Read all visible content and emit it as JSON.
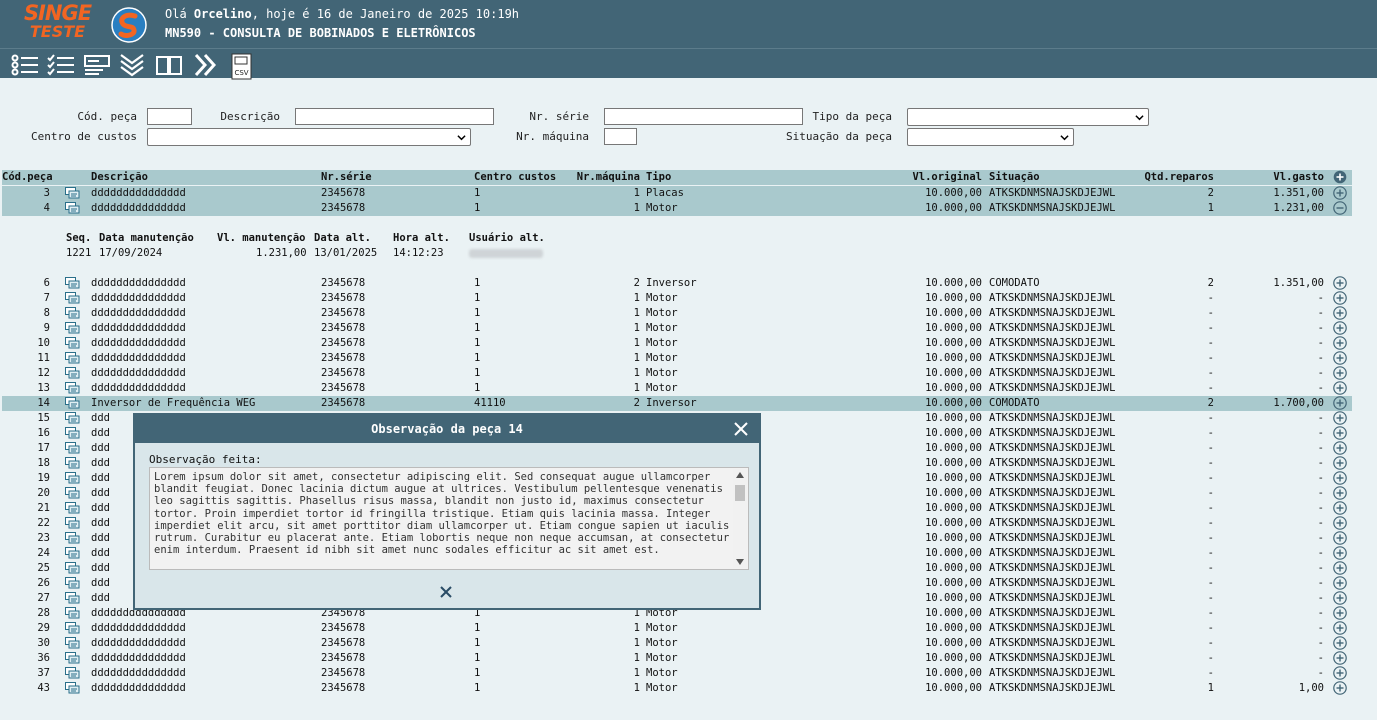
{
  "header": {
    "logo_line1": "SINGE",
    "logo_line2": "TESTE",
    "greeting_prefix": "Olá ",
    "user": "Orcelino",
    "greeting_suffix": ", hoje é 16 de Janeiro de 2025 10:19h",
    "title": "MN590 - CONSULTA DE BOBINADOS E ELETRÔNICOS"
  },
  "toolbar": {
    "icons": [
      "list-icon",
      "checklist-icon",
      "form-icon",
      "expand-all-icon",
      "manual-icon",
      "next-icon",
      "csv-export-icon"
    ],
    "csv_label": "CSV"
  },
  "filters": {
    "cod_peca": "Cód. peça",
    "descricao": "Descrição",
    "nr_serie": "Nr. série",
    "tipo_peca": "Tipo da peça",
    "centro_custos": "Centro de custos",
    "nr_maquina": "Nr. máquina",
    "situacao_peca": "Situação da peça"
  },
  "grid": {
    "headers": {
      "cod": "Cód.peça",
      "desc": "Descrição",
      "serie": "Nr.série",
      "cc": "Centro custos",
      "nm": "Nr.máquina",
      "tipo": "Tipo",
      "vo": "Vl.original",
      "sit": "Situação",
      "qt": "Qtd.reparos",
      "vg": "Vl.gasto"
    }
  },
  "rows_top": [
    {
      "cod": "3",
      "desc": "ddddddddddddddd",
      "serie": "2345678",
      "cc": "1",
      "nm": "1",
      "tipo": "Placas",
      "vo": "10.000,00",
      "sit": "ATKSKDNMSNAJSKDJEJWL",
      "qt": "2",
      "vg": "1.351,00",
      "exp": "+"
    },
    {
      "cod": "4",
      "desc": "ddddddddddddddd",
      "serie": "2345678",
      "cc": "1",
      "nm": "1",
      "tipo": "Motor",
      "vo": "10.000,00",
      "sit": "ATKSKDNMSNAJSKDJEJWL",
      "qt": "1",
      "vg": "1.231,00",
      "exp": "-"
    }
  ],
  "sub": {
    "h_seq": "Seq.",
    "h_data": "Data manutenção",
    "h_vl": "Vl. manutenção",
    "h_alt": "Data alt.",
    "h_hora": "Hora alt.",
    "h_user": "Usuário alt.",
    "seq": "1221",
    "data": "17/09/2024",
    "vl": "1.231,00",
    "alt": "13/01/2025",
    "hora": "14:12:23"
  },
  "rows": [
    {
      "cod": "6",
      "desc": "ddddddddddddddd",
      "serie": "2345678",
      "cc": "1",
      "nm": "2",
      "tipo": "Inversor",
      "vo": "10.000,00",
      "sit": "COMODATO",
      "qt": "2",
      "vg": "1.351,00"
    },
    {
      "cod": "7",
      "desc": "ddddddddddddddd",
      "serie": "2345678",
      "cc": "1",
      "nm": "1",
      "tipo": "Motor",
      "vo": "10.000,00",
      "sit": "ATKSKDNMSNAJSKDJEJWL",
      "qt": "-",
      "vg": "-"
    },
    {
      "cod": "8",
      "desc": "ddddddddddddddd",
      "serie": "2345678",
      "cc": "1",
      "nm": "1",
      "tipo": "Motor",
      "vo": "10.000,00",
      "sit": "ATKSKDNMSNAJSKDJEJWL",
      "qt": "-",
      "vg": "-"
    },
    {
      "cod": "9",
      "desc": "ddddddddddddddd",
      "serie": "2345678",
      "cc": "1",
      "nm": "1",
      "tipo": "Motor",
      "vo": "10.000,00",
      "sit": "ATKSKDNMSNAJSKDJEJWL",
      "qt": "-",
      "vg": "-"
    },
    {
      "cod": "10",
      "desc": "ddddddddddddddd",
      "serie": "2345678",
      "cc": "1",
      "nm": "1",
      "tipo": "Motor",
      "vo": "10.000,00",
      "sit": "ATKSKDNMSNAJSKDJEJWL",
      "qt": "-",
      "vg": "-"
    },
    {
      "cod": "11",
      "desc": "ddddddddddddddd",
      "serie": "2345678",
      "cc": "1",
      "nm": "1",
      "tipo": "Motor",
      "vo": "10.000,00",
      "sit": "ATKSKDNMSNAJSKDJEJWL",
      "qt": "-",
      "vg": "-"
    },
    {
      "cod": "12",
      "desc": "ddddddddddddddd",
      "serie": "2345678",
      "cc": "1",
      "nm": "1",
      "tipo": "Motor",
      "vo": "10.000,00",
      "sit": "ATKSKDNMSNAJSKDJEJWL",
      "qt": "-",
      "vg": "-"
    },
    {
      "cod": "13",
      "desc": "ddddddddddddddd",
      "serie": "2345678",
      "cc": "1",
      "nm": "1",
      "tipo": "Motor",
      "vo": "10.000,00",
      "sit": "ATKSKDNMSNAJSKDJEJWL",
      "qt": "-",
      "vg": "-"
    },
    {
      "cod": "14",
      "desc": "Inversor de Frequência WEG",
      "serie": "2345678",
      "cc": "41110",
      "nm": "2",
      "tipo": "Inversor",
      "vo": "10.000,00",
      "sit": "COMODATO",
      "qt": "2",
      "vg": "1.700,00",
      "hl": true
    },
    {
      "cod": "15",
      "desc": "ddd",
      "vo": "10.000,00",
      "sit": "ATKSKDNMSNAJSKDJEJWL",
      "qt": "-",
      "vg": "-",
      "hidden": true
    },
    {
      "cod": "16",
      "desc": "ddd",
      "vo": "10.000,00",
      "sit": "ATKSKDNMSNAJSKDJEJWL",
      "qt": "-",
      "vg": "-",
      "hidden": true
    },
    {
      "cod": "17",
      "desc": "ddd",
      "vo": "10.000,00",
      "sit": "ATKSKDNMSNAJSKDJEJWL",
      "qt": "-",
      "vg": "-",
      "hidden": true
    },
    {
      "cod": "18",
      "desc": "ddd",
      "vo": "10.000,00",
      "sit": "ATKSKDNMSNAJSKDJEJWL",
      "qt": "-",
      "vg": "-",
      "hidden": true
    },
    {
      "cod": "19",
      "desc": "ddd",
      "vo": "10.000,00",
      "sit": "ATKSKDNMSNAJSKDJEJWL",
      "qt": "-",
      "vg": "-",
      "hidden": true
    },
    {
      "cod": "20",
      "desc": "ddd",
      "vo": "10.000,00",
      "sit": "ATKSKDNMSNAJSKDJEJWL",
      "qt": "-",
      "vg": "-",
      "hidden": true
    },
    {
      "cod": "21",
      "desc": "ddd",
      "vo": "10.000,00",
      "sit": "ATKSKDNMSNAJSKDJEJWL",
      "qt": "-",
      "vg": "-",
      "hidden": true
    },
    {
      "cod": "22",
      "desc": "ddd",
      "vo": "10.000,00",
      "sit": "ATKSKDNMSNAJSKDJEJWL",
      "qt": "-",
      "vg": "-",
      "hidden": true
    },
    {
      "cod": "23",
      "desc": "ddd",
      "vo": "10.000,00",
      "sit": "ATKSKDNMSNAJSKDJEJWL",
      "qt": "-",
      "vg": "-",
      "hidden": true
    },
    {
      "cod": "24",
      "desc": "ddd",
      "vo": "10.000,00",
      "sit": "ATKSKDNMSNAJSKDJEJWL",
      "qt": "-",
      "vg": "-",
      "hidden": true
    },
    {
      "cod": "25",
      "desc": "ddd",
      "vo": "10.000,00",
      "sit": "ATKSKDNMSNAJSKDJEJWL",
      "qt": "-",
      "vg": "-",
      "hidden": true
    },
    {
      "cod": "26",
      "desc": "ddd",
      "vo": "10.000,00",
      "sit": "ATKSKDNMSNAJSKDJEJWL",
      "qt": "-",
      "vg": "-",
      "hidden": true
    },
    {
      "cod": "27",
      "desc": "ddd",
      "vo": "10.000,00",
      "sit": "ATKSKDNMSNAJSKDJEJWL",
      "qt": "-",
      "vg": "-",
      "hidden": true
    },
    {
      "cod": "28",
      "desc": "ddddddddddddddd",
      "serie": "2345678",
      "cc": "1",
      "nm": "1",
      "tipo": "Motor",
      "vo": "10.000,00",
      "sit": "ATKSKDNMSNAJSKDJEJWL",
      "qt": "-",
      "vg": "-"
    },
    {
      "cod": "29",
      "desc": "ddddddddddddddd",
      "serie": "2345678",
      "cc": "1",
      "nm": "1",
      "tipo": "Motor",
      "vo": "10.000,00",
      "sit": "ATKSKDNMSNAJSKDJEJWL",
      "qt": "-",
      "vg": "-"
    },
    {
      "cod": "30",
      "desc": "ddddddddddddddd",
      "serie": "2345678",
      "cc": "1",
      "nm": "1",
      "tipo": "Motor",
      "vo": "10.000,00",
      "sit": "ATKSKDNMSNAJSKDJEJWL",
      "qt": "-",
      "vg": "-"
    },
    {
      "cod": "36",
      "desc": "ddddddddddddddd",
      "serie": "2345678",
      "cc": "1",
      "nm": "1",
      "tipo": "Motor",
      "vo": "10.000,00",
      "sit": "ATKSKDNMSNAJSKDJEJWL",
      "qt": "-",
      "vg": "-"
    },
    {
      "cod": "37",
      "desc": "ddddddddddddddd",
      "serie": "2345678",
      "cc": "1",
      "nm": "1",
      "tipo": "Motor",
      "vo": "10.000,00",
      "sit": "ATKSKDNMSNAJSKDJEJWL",
      "qt": "-",
      "vg": "-"
    },
    {
      "cod": "43",
      "desc": "ddddddddddddddd",
      "serie": "2345678",
      "cc": "1",
      "nm": "1",
      "tipo": "Motor",
      "vo": "10.000,00",
      "sit": "ATKSKDNMSNAJSKDJEJWL",
      "qt": "1",
      "vg": "1,00"
    }
  ],
  "modal": {
    "title": "Observação da peça 14",
    "label": "Observação feita:",
    "text": "Lorem ipsum dolor sit amet, consectetur adipiscing elit. Sed consequat augue ullamcorper blandit feugiat. Donec lacinia dictum augue at ultrices. Vestibulum pellentesque venenatis leo sagittis sagittis. Phasellus risus massa, blandit non justo id, maximus consectetur tortor. Proin imperdiet tortor id fringilla tristique. Etiam quis lacinia massa. Integer imperdiet elit arcu, sit amet porttitor diam ullamcorper ut. Etiam congue sapien ut iaculis rutrum. Curabitur eu placerat ante. Etiam lobortis neque non neque accumsan, at consectetur enim interdum. Praesent id nibh sit amet nunc sodales efficitur ac sit amet est."
  },
  "colors": {
    "header": "#426576",
    "highlight": "#a9c9cd",
    "background": "#eaf2f4",
    "logo": "#f26522"
  }
}
